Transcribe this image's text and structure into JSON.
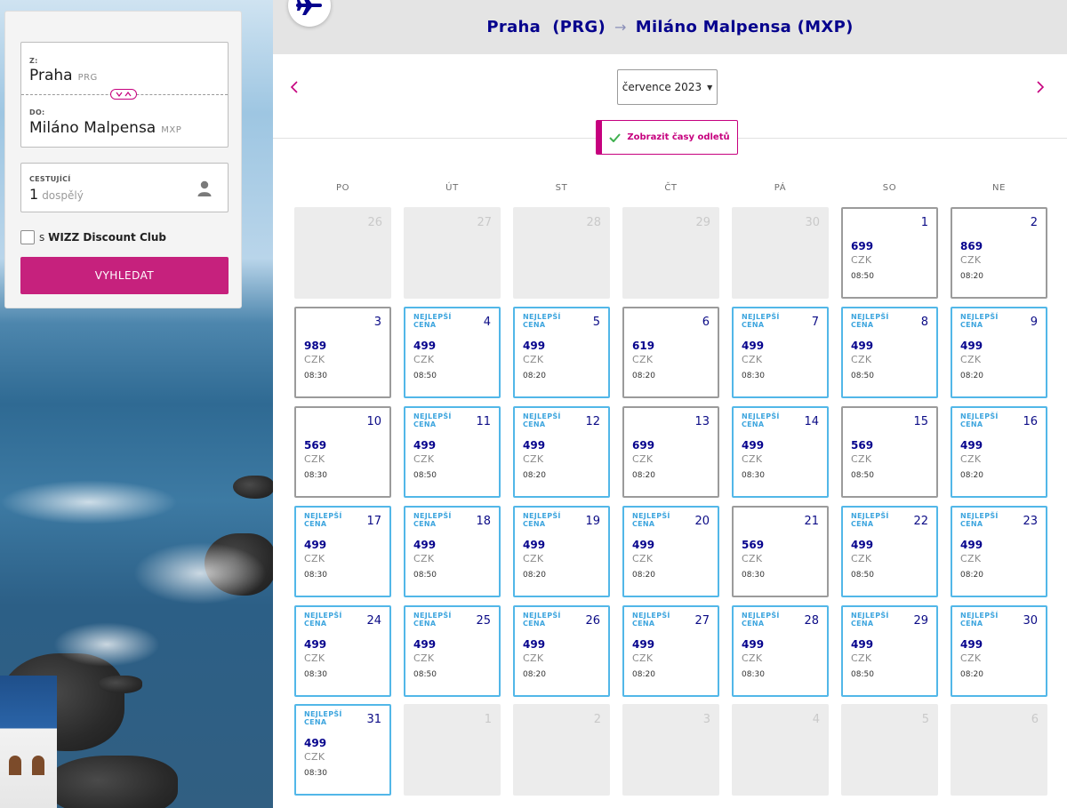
{
  "search": {
    "from_label": "Z:",
    "from_city": "Praha",
    "from_code": "PRG",
    "to_label": "DO:",
    "to_city": "Miláno Malpensa",
    "to_code": "MXP",
    "travelers_label": "CESTUJÍCÍ",
    "travelers_count": "1",
    "travelers_unit": "dospělý",
    "discount_prefix": "s",
    "discount_brand": "WIZZ Discount Club",
    "search_button": "VYHLEDAT"
  },
  "calendar": {
    "origin": "Praha",
    "origin_code": "(PRG)",
    "arrow": "→",
    "destination": "Miláno Malpensa",
    "destination_code": "(MXP)",
    "month": "července 2023",
    "show_times_button": "Zobrazit časy odletů",
    "weekdays": [
      "PO",
      "ÚT",
      "ST",
      "ČT",
      "PÁ",
      "SO",
      "NE"
    ],
    "best_label_line1": "NEJLEPŠÍ",
    "best_label_line2": "CENA",
    "currency": "CZK",
    "days": [
      {
        "day": "26",
        "state": "off"
      },
      {
        "day": "27",
        "state": "off"
      },
      {
        "day": "28",
        "state": "off"
      },
      {
        "day": "29",
        "state": "off"
      },
      {
        "day": "30",
        "state": "off"
      },
      {
        "day": "1",
        "state": "reg",
        "price": "699",
        "time": "08:50"
      },
      {
        "day": "2",
        "state": "reg",
        "price": "869",
        "time": "08:20"
      },
      {
        "day": "3",
        "state": "reg",
        "price": "989",
        "time": "08:30"
      },
      {
        "day": "4",
        "state": "best",
        "price": "499",
        "time": "08:50"
      },
      {
        "day": "5",
        "state": "best",
        "price": "499",
        "time": "08:20"
      },
      {
        "day": "6",
        "state": "reg",
        "price": "619",
        "time": "08:20"
      },
      {
        "day": "7",
        "state": "best",
        "price": "499",
        "time": "08:30"
      },
      {
        "day": "8",
        "state": "best",
        "price": "499",
        "time": "08:50"
      },
      {
        "day": "9",
        "state": "best",
        "price": "499",
        "time": "08:20"
      },
      {
        "day": "10",
        "state": "reg",
        "price": "569",
        "time": "08:30"
      },
      {
        "day": "11",
        "state": "best",
        "price": "499",
        "time": "08:50"
      },
      {
        "day": "12",
        "state": "best",
        "price": "499",
        "time": "08:20"
      },
      {
        "day": "13",
        "state": "reg",
        "price": "699",
        "time": "08:20"
      },
      {
        "day": "14",
        "state": "best",
        "price": "499",
        "time": "08:30"
      },
      {
        "day": "15",
        "state": "reg",
        "price": "569",
        "time": "08:50"
      },
      {
        "day": "16",
        "state": "best",
        "price": "499",
        "time": "08:20"
      },
      {
        "day": "17",
        "state": "best",
        "price": "499",
        "time": "08:30"
      },
      {
        "day": "18",
        "state": "best",
        "price": "499",
        "time": "08:50"
      },
      {
        "day": "19",
        "state": "best",
        "price": "499",
        "time": "08:20"
      },
      {
        "day": "20",
        "state": "best",
        "price": "499",
        "time": "08:20"
      },
      {
        "day": "21",
        "state": "reg",
        "price": "569",
        "time": "08:30"
      },
      {
        "day": "22",
        "state": "best",
        "price": "499",
        "time": "08:50"
      },
      {
        "day": "23",
        "state": "best",
        "price": "499",
        "time": "08:20"
      },
      {
        "day": "24",
        "state": "best",
        "price": "499",
        "time": "08:30"
      },
      {
        "day": "25",
        "state": "best",
        "price": "499",
        "time": "08:50"
      },
      {
        "day": "26",
        "state": "best",
        "price": "499",
        "time": "08:20"
      },
      {
        "day": "27",
        "state": "best",
        "price": "499",
        "time": "08:20"
      },
      {
        "day": "28",
        "state": "best",
        "price": "499",
        "time": "08:30"
      },
      {
        "day": "29",
        "state": "best",
        "price": "499",
        "time": "08:50"
      },
      {
        "day": "30",
        "state": "best",
        "price": "499",
        "time": "08:20"
      },
      {
        "day": "31",
        "state": "best",
        "price": "499",
        "time": "08:30"
      },
      {
        "day": "1",
        "state": "off"
      },
      {
        "day": "2",
        "state": "off"
      },
      {
        "day": "3",
        "state": "off"
      },
      {
        "day": "4",
        "state": "off"
      },
      {
        "day": "5",
        "state": "off"
      },
      {
        "day": "6",
        "state": "off"
      }
    ]
  },
  "colors": {
    "brand_magenta": "#c6217d",
    "navy_text": "#06038d",
    "best_price_border": "#52b7e8",
    "regular_border": "#9b9b9b"
  }
}
